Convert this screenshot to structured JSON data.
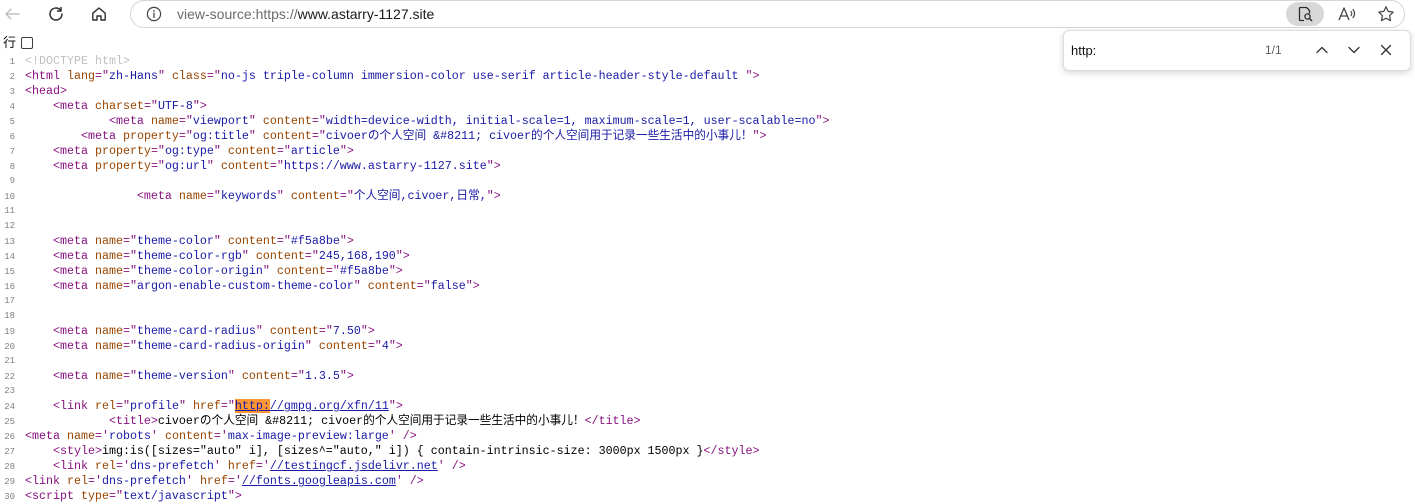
{
  "toolbar": {
    "url_scheme": "view-source:https://",
    "url_host": "www.astarry-1127.site"
  },
  "icons": {
    "back": "back-arrow-icon",
    "reload": "reload-icon",
    "home": "home-icon",
    "site_info": "info-icon",
    "find_on_page": "find-on-page-icon",
    "read_aloud": "read-aloud-icon",
    "favorite": "star-icon",
    "find_previous": "chevron-up-icon",
    "find_next": "chevron-down-icon",
    "find_close": "close-icon"
  },
  "colors": {
    "tag": "#881280",
    "attr": "#994500",
    "val": "#1a1aa6",
    "doctype": "#c0c0c0",
    "text": "#000000",
    "line_number": "#808080",
    "match_highlight": "#ff9632",
    "url_scheme": "#6b6b6b",
    "url_host": "#1a1a1a",
    "active_icon_bg": "#d8d8d8"
  },
  "find_bar": {
    "query": "http:",
    "match_count": "1/1"
  },
  "source": {
    "line_wrap_label": "行",
    "lines": [
      {
        "n": 1,
        "tokens": [
          {
            "doctype": "<!DOCTYPE html>"
          }
        ]
      },
      {
        "n": 2,
        "tokens": [
          {
            "tag": "<html "
          },
          {
            "attr": "lang"
          },
          {
            "tag": "=\""
          },
          {
            "val": "zh-Hans"
          },
          {
            "tag": "\" "
          },
          {
            "attr": "class"
          },
          {
            "tag": "=\""
          },
          {
            "val": "no-js triple-column immersion-color use-serif article-header-style-default "
          },
          {
            "tag": "\">"
          }
        ]
      },
      {
        "n": 3,
        "tokens": [
          {
            "tag": "<head>"
          }
        ]
      },
      {
        "n": 4,
        "tokens": [
          {
            "text": "    "
          },
          {
            "tag": "<meta "
          },
          {
            "attr": "charset"
          },
          {
            "tag": "=\""
          },
          {
            "val": "UTF-8"
          },
          {
            "tag": "\">"
          }
        ]
      },
      {
        "n": 5,
        "tokens": [
          {
            "text": "            "
          },
          {
            "tag": "<meta "
          },
          {
            "attr": "name"
          },
          {
            "tag": "=\""
          },
          {
            "val": "viewport"
          },
          {
            "tag": "\" "
          },
          {
            "attr": "content"
          },
          {
            "tag": "=\""
          },
          {
            "val": "width=device-width, initial-scale=1, maximum-scale=1, user-scalable=no"
          },
          {
            "tag": "\">"
          }
        ]
      },
      {
        "n": 6,
        "tokens": [
          {
            "text": "        "
          },
          {
            "tag": "<meta "
          },
          {
            "attr": "property"
          },
          {
            "tag": "=\""
          },
          {
            "val": "og:title"
          },
          {
            "tag": "\" "
          },
          {
            "attr": "content"
          },
          {
            "tag": "=\""
          },
          {
            "val": "civoerの个人空间 &#8211; civoer的个人空间用于记录一些生活中的小事儿！"
          },
          {
            "tag": "\">"
          }
        ]
      },
      {
        "n": 7,
        "tokens": [
          {
            "text": "    "
          },
          {
            "tag": "<meta "
          },
          {
            "attr": "property"
          },
          {
            "tag": "=\""
          },
          {
            "val": "og:type"
          },
          {
            "tag": "\" "
          },
          {
            "attr": "content"
          },
          {
            "tag": "=\""
          },
          {
            "val": "article"
          },
          {
            "tag": "\">"
          }
        ]
      },
      {
        "n": 8,
        "tokens": [
          {
            "text": "    "
          },
          {
            "tag": "<meta "
          },
          {
            "attr": "property"
          },
          {
            "tag": "=\""
          },
          {
            "val": "og:url"
          },
          {
            "tag": "\" "
          },
          {
            "attr": "content"
          },
          {
            "tag": "=\""
          },
          {
            "val": "https://www.astarry-1127.site"
          },
          {
            "tag": "\">"
          }
        ]
      },
      {
        "n": 9,
        "tokens": []
      },
      {
        "n": 10,
        "tokens": [
          {
            "text": "                "
          },
          {
            "tag": "<meta "
          },
          {
            "attr": "name"
          },
          {
            "tag": "=\""
          },
          {
            "val": "keywords"
          },
          {
            "tag": "\" "
          },
          {
            "attr": "content"
          },
          {
            "tag": "=\""
          },
          {
            "val": "个人空间,civoer,日常,"
          },
          {
            "tag": "\">"
          }
        ]
      },
      {
        "n": 11,
        "tokens": []
      },
      {
        "n": 12,
        "tokens": []
      },
      {
        "n": 13,
        "tokens": [
          {
            "text": "    "
          },
          {
            "tag": "<meta "
          },
          {
            "attr": "name"
          },
          {
            "tag": "=\""
          },
          {
            "val": "theme-color"
          },
          {
            "tag": "\" "
          },
          {
            "attr": "content"
          },
          {
            "tag": "=\""
          },
          {
            "val": "#f5a8be"
          },
          {
            "tag": "\">"
          }
        ]
      },
      {
        "n": 14,
        "tokens": [
          {
            "text": "    "
          },
          {
            "tag": "<meta "
          },
          {
            "attr": "name"
          },
          {
            "tag": "=\""
          },
          {
            "val": "theme-color-rgb"
          },
          {
            "tag": "\" "
          },
          {
            "attr": "content"
          },
          {
            "tag": "=\""
          },
          {
            "val": "245,168,190"
          },
          {
            "tag": "\">"
          }
        ]
      },
      {
        "n": 15,
        "tokens": [
          {
            "text": "    "
          },
          {
            "tag": "<meta "
          },
          {
            "attr": "name"
          },
          {
            "tag": "=\""
          },
          {
            "val": "theme-color-origin"
          },
          {
            "tag": "\" "
          },
          {
            "attr": "content"
          },
          {
            "tag": "=\""
          },
          {
            "val": "#f5a8be"
          },
          {
            "tag": "\">"
          }
        ]
      },
      {
        "n": 16,
        "tokens": [
          {
            "text": "    "
          },
          {
            "tag": "<meta "
          },
          {
            "attr": "name"
          },
          {
            "tag": "=\""
          },
          {
            "val": "argon-enable-custom-theme-color"
          },
          {
            "tag": "\" "
          },
          {
            "attr": "content"
          },
          {
            "tag": "=\""
          },
          {
            "val": "false"
          },
          {
            "tag": "\">"
          }
        ]
      },
      {
        "n": 17,
        "tokens": []
      },
      {
        "n": 18,
        "tokens": []
      },
      {
        "n": 19,
        "tokens": [
          {
            "text": "    "
          },
          {
            "tag": "<meta "
          },
          {
            "attr": "name"
          },
          {
            "tag": "=\""
          },
          {
            "val": "theme-card-radius"
          },
          {
            "tag": "\" "
          },
          {
            "attr": "content"
          },
          {
            "tag": "=\""
          },
          {
            "val": "7.50"
          },
          {
            "tag": "\">"
          }
        ]
      },
      {
        "n": 20,
        "tokens": [
          {
            "text": "    "
          },
          {
            "tag": "<meta "
          },
          {
            "attr": "name"
          },
          {
            "tag": "=\""
          },
          {
            "val": "theme-card-radius-origin"
          },
          {
            "tag": "\" "
          },
          {
            "attr": "content"
          },
          {
            "tag": "=\""
          },
          {
            "val": "4"
          },
          {
            "tag": "\">"
          }
        ]
      },
      {
        "n": 21,
        "tokens": []
      },
      {
        "n": 22,
        "tokens": [
          {
            "text": "    "
          },
          {
            "tag": "<meta "
          },
          {
            "attr": "name"
          },
          {
            "tag": "=\""
          },
          {
            "val": "theme-version"
          },
          {
            "tag": "\" "
          },
          {
            "attr": "content"
          },
          {
            "tag": "=\""
          },
          {
            "val": "1.3.5"
          },
          {
            "tag": "\">"
          }
        ]
      },
      {
        "n": 23,
        "tokens": []
      },
      {
        "n": 24,
        "tokens": [
          {
            "text": "    "
          },
          {
            "tag": "<link "
          },
          {
            "attr": "rel"
          },
          {
            "tag": "=\""
          },
          {
            "val": "profile"
          },
          {
            "tag": "\" "
          },
          {
            "attr": "href"
          },
          {
            "tag": "=\""
          },
          {
            "match": "http:"
          },
          {
            "link": "//gmpg.org/xfn/11"
          },
          {
            "tag": "\">"
          }
        ]
      },
      {
        "n": 25,
        "tokens": [
          {
            "text": "            "
          },
          {
            "tag": "<title>"
          },
          {
            "text": "civoerの个人空间 &#8211; civoer的个人空间用于记录一些生活中的小事儿！"
          },
          {
            "tag": "</title>"
          }
        ]
      },
      {
        "n": 26,
        "tokens": [
          {
            "tag": "<meta "
          },
          {
            "attr": "name"
          },
          {
            "tag": "='"
          },
          {
            "val": "robots"
          },
          {
            "tag": "' "
          },
          {
            "attr": "content"
          },
          {
            "tag": "='"
          },
          {
            "val": "max-image-preview:large"
          },
          {
            "tag": "' />"
          }
        ]
      },
      {
        "n": 27,
        "tokens": [
          {
            "text": "    "
          },
          {
            "tag": "<style>"
          },
          {
            "text": "img:is([sizes=\"auto\" i], [sizes^=\"auto,\" i]) { contain-intrinsic-size: 3000px 1500px }"
          },
          {
            "tag": "</style>"
          }
        ]
      },
      {
        "n": 28,
        "tokens": [
          {
            "text": "    "
          },
          {
            "tag": "<link "
          },
          {
            "attr": "rel"
          },
          {
            "tag": "='"
          },
          {
            "val": "dns-prefetch"
          },
          {
            "tag": "' "
          },
          {
            "attr": "href"
          },
          {
            "tag": "='"
          },
          {
            "link": "//testingcf.jsdelivr.net"
          },
          {
            "tag": "' />"
          }
        ]
      },
      {
        "n": 29,
        "tokens": [
          {
            "tag": "<link "
          },
          {
            "attr": "rel"
          },
          {
            "tag": "='"
          },
          {
            "val": "dns-prefetch"
          },
          {
            "tag": "' "
          },
          {
            "attr": "href"
          },
          {
            "tag": "='"
          },
          {
            "link": "//fonts.googleapis.com"
          },
          {
            "tag": "' />"
          }
        ]
      },
      {
        "n": 30,
        "tokens": [
          {
            "tag": "<script "
          },
          {
            "attr": "type"
          },
          {
            "tag": "=\""
          },
          {
            "val": "text/javascript"
          },
          {
            "tag": "\">"
          }
        ]
      }
    ]
  }
}
